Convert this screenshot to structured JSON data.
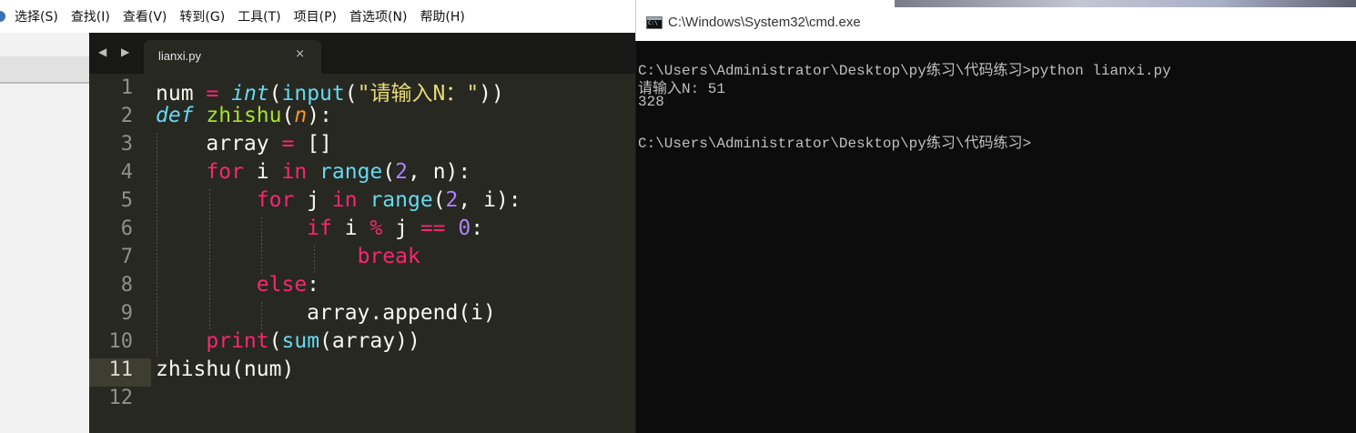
{
  "sublime": {
    "menu": [
      "选择(S)",
      "查找(I)",
      "查看(V)",
      "转到(G)",
      "工具(T)",
      "项目(P)",
      "首选项(N)",
      "帮助(H)"
    ],
    "nav_arrows": "◀ ▶",
    "tab": {
      "label": "lianxi.py",
      "close": "×"
    },
    "active_line": 11,
    "lines": [
      {
        "num": "1",
        "tokens": [
          [
            "",
            "num "
          ],
          [
            "kw",
            "="
          ],
          [
            "",
            " "
          ],
          [
            "sto",
            "int"
          ],
          [
            "",
            "("
          ],
          [
            "bi",
            "input"
          ],
          [
            "",
            "("
          ],
          [
            "str",
            "\"请输入N：\""
          ],
          [
            "",
            "))"
          ]
        ]
      },
      {
        "num": "2",
        "tokens": [
          [
            "sto",
            "def"
          ],
          [
            "",
            " "
          ],
          [
            "fn",
            "zhishu"
          ],
          [
            "",
            "("
          ],
          [
            "param",
            "n"
          ],
          [
            "",
            "):"
          ]
        ]
      },
      {
        "num": "3",
        "tokens": [
          [
            "",
            "    array "
          ],
          [
            "kw",
            "="
          ],
          [
            "",
            " []"
          ]
        ]
      },
      {
        "num": "4",
        "tokens": [
          [
            "",
            "    "
          ],
          [
            "kw",
            "for"
          ],
          [
            "",
            " i "
          ],
          [
            "kw",
            "in"
          ],
          [
            "",
            " "
          ],
          [
            "bi",
            "range"
          ],
          [
            "",
            "("
          ],
          [
            "num",
            "2"
          ],
          [
            "",
            ", n):"
          ]
        ]
      },
      {
        "num": "5",
        "tokens": [
          [
            "",
            "        "
          ],
          [
            "kw",
            "for"
          ],
          [
            "",
            " j "
          ],
          [
            "kw",
            "in"
          ],
          [
            "",
            " "
          ],
          [
            "bi",
            "range"
          ],
          [
            "",
            "("
          ],
          [
            "num",
            "2"
          ],
          [
            "",
            ", i):"
          ]
        ]
      },
      {
        "num": "6",
        "tokens": [
          [
            "",
            "            "
          ],
          [
            "kw",
            "if"
          ],
          [
            "",
            " i "
          ],
          [
            "kw",
            "%"
          ],
          [
            "",
            " j "
          ],
          [
            "kw",
            "=="
          ],
          [
            "",
            " "
          ],
          [
            "num",
            "0"
          ],
          [
            "",
            ":"
          ]
        ]
      },
      {
        "num": "7",
        "tokens": [
          [
            "",
            "                "
          ],
          [
            "kw",
            "break"
          ]
        ]
      },
      {
        "num": "8",
        "tokens": [
          [
            "",
            "        "
          ],
          [
            "kw",
            "else"
          ],
          [
            "",
            ":"
          ]
        ]
      },
      {
        "num": "9",
        "tokens": [
          [
            "",
            "            array.append(i)"
          ]
        ]
      },
      {
        "num": "10",
        "tokens": [
          [
            "",
            "    "
          ],
          [
            "kw",
            "print"
          ],
          [
            "",
            "("
          ],
          [
            "bi",
            "sum"
          ],
          [
            "",
            "(array))"
          ]
        ]
      },
      {
        "num": "11",
        "tokens": [
          [
            "",
            "zhishu(num)"
          ]
        ]
      },
      {
        "num": "12",
        "tokens": []
      }
    ]
  },
  "cmd": {
    "title": "C:\\Windows\\System32\\cmd.exe",
    "lines": [
      "C:\\Users\\Administrator\\Desktop\\py练习\\代码练习>python lianxi.py",
      "请输入N: 51",
      "328",
      "",
      "C:\\Users\\Administrator\\Desktop\\py练习\\代码练习>"
    ]
  }
}
